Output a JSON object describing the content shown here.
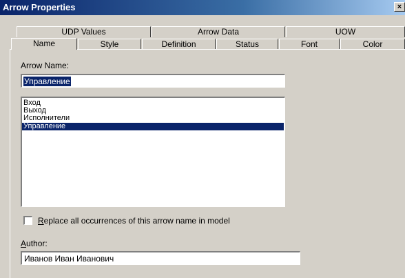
{
  "window": {
    "title": "Arrow Properties",
    "close_glyph": "×"
  },
  "tabs_back": [
    {
      "label": "UDP Values"
    },
    {
      "label": "Arrow Data"
    },
    {
      "label": "UOW"
    }
  ],
  "tabs_front": [
    {
      "label": "Name",
      "active": true
    },
    {
      "label": "Style"
    },
    {
      "label": "Definition"
    },
    {
      "label": "Status"
    },
    {
      "label": "Font"
    },
    {
      "label": "Color"
    }
  ],
  "arrow_name": {
    "label": "Arrow Name:",
    "value": "Управление"
  },
  "name_list": {
    "items": [
      "Вход",
      "Выход",
      "Исполнители",
      "Управление"
    ],
    "selected_index": 3
  },
  "replace_checkbox": {
    "accelerator": "R",
    "label_rest": "eplace all occurrences of this arrow name in model",
    "checked": false
  },
  "author": {
    "accelerator": "A",
    "label_rest": "uthor:",
    "value": "Иванов Иван Иванович"
  }
}
